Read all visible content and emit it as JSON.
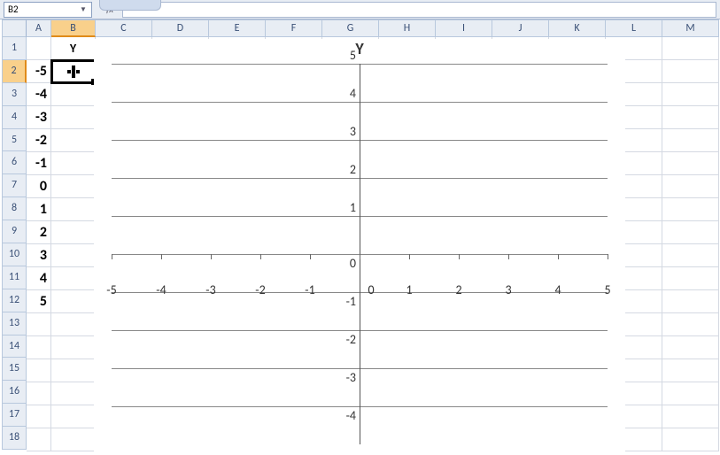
{
  "name_box": "B2",
  "formula_bar": "",
  "columns": [
    {
      "label": "A",
      "width": 28
    },
    {
      "label": "B",
      "width": 50
    },
    {
      "label": "C",
      "width": 64
    },
    {
      "label": "D",
      "width": 64
    },
    {
      "label": "E",
      "width": 64
    },
    {
      "label": "F",
      "width": 64
    },
    {
      "label": "G",
      "width": 64
    },
    {
      "label": "H",
      "width": 64
    },
    {
      "label": "I",
      "width": 64
    },
    {
      "label": "J",
      "width": 64
    },
    {
      "label": "K",
      "width": 64
    },
    {
      "label": "L",
      "width": 64
    },
    {
      "label": "M",
      "width": 64
    }
  ],
  "rows": [
    {
      "num": 1,
      "cells": [
        "",
        "Y",
        "",
        "",
        "",
        "",
        "",
        "",
        "",
        "",
        "",
        "",
        ""
      ]
    },
    {
      "num": 2,
      "cells": [
        "-5",
        "",
        "",
        "",
        "",
        "",
        "",
        "",
        "",
        "",
        "",
        "",
        ""
      ]
    },
    {
      "num": 3,
      "cells": [
        "-4",
        "",
        "",
        "",
        "",
        "",
        "",
        "",
        "",
        "",
        "",
        "",
        ""
      ]
    },
    {
      "num": 4,
      "cells": [
        "-3",
        "",
        "",
        "",
        "",
        "",
        "",
        "",
        "",
        "",
        "",
        "",
        ""
      ]
    },
    {
      "num": 5,
      "cells": [
        "-2",
        "",
        "",
        "",
        "",
        "",
        "",
        "",
        "",
        "",
        "",
        "",
        ""
      ]
    },
    {
      "num": 6,
      "cells": [
        "-1",
        "",
        "",
        "",
        "",
        "",
        "",
        "",
        "",
        "",
        "",
        "",
        ""
      ]
    },
    {
      "num": 7,
      "cells": [
        "0",
        "",
        "",
        "",
        "",
        "",
        "",
        "",
        "",
        "",
        "",
        "",
        ""
      ]
    },
    {
      "num": 8,
      "cells": [
        "1",
        "",
        "",
        "",
        "",
        "",
        "",
        "",
        "",
        "",
        "",
        "",
        ""
      ]
    },
    {
      "num": 9,
      "cells": [
        "2",
        "",
        "",
        "",
        "",
        "",
        "",
        "",
        "",
        "",
        "",
        "",
        ""
      ]
    },
    {
      "num": 10,
      "cells": [
        "3",
        "",
        "",
        "",
        "",
        "",
        "",
        "",
        "",
        "",
        "",
        "",
        ""
      ]
    },
    {
      "num": 11,
      "cells": [
        "4",
        "",
        "",
        "",
        "",
        "",
        "",
        "",
        "",
        "",
        "",
        "",
        ""
      ]
    },
    {
      "num": 12,
      "cells": [
        "5",
        "",
        "",
        "",
        "",
        "",
        "",
        "",
        "",
        "",
        "",
        "",
        ""
      ]
    },
    {
      "num": 13,
      "cells": [
        "",
        "",
        "",
        "",
        "",
        "",
        "",
        "",
        "",
        "",
        "",
        "",
        ""
      ]
    },
    {
      "num": 14,
      "cells": [
        "",
        "",
        "",
        "",
        "",
        "",
        "",
        "",
        "",
        "",
        "",
        "",
        ""
      ]
    },
    {
      "num": 15,
      "cells": [
        "",
        "",
        "",
        "",
        "",
        "",
        "",
        "",
        "",
        "",
        "",
        "",
        ""
      ]
    },
    {
      "num": 16,
      "cells": [
        "",
        "",
        "",
        "",
        "",
        "",
        "",
        "",
        "",
        "",
        "",
        "",
        ""
      ]
    },
    {
      "num": 17,
      "cells": [
        "",
        "",
        "",
        "",
        "",
        "",
        "",
        "",
        "",
        "",
        "",
        "",
        ""
      ]
    },
    {
      "num": 18,
      "cells": [
        "",
        "",
        "",
        "",
        "",
        "",
        "",
        "",
        "",
        "",
        "",
        "",
        ""
      ]
    }
  ],
  "selected_cell": {
    "row": 2,
    "col": 1
  },
  "selected_col": 1,
  "chart_data": {
    "type": "scatter",
    "title": "Y",
    "x_ticks": [
      -5,
      -4,
      -3,
      -2,
      -1,
      0,
      1,
      2,
      3,
      4,
      5
    ],
    "y_ticks": [
      5,
      4,
      3,
      2,
      1,
      0,
      -1,
      -2,
      -3,
      -4
    ],
    "xlim": [
      -5,
      5
    ],
    "ylim": [
      -5,
      5
    ],
    "y_axis_at_x": 0,
    "x_axis_at_y": 0,
    "series": [
      {
        "name": "Y",
        "x": [],
        "y": []
      }
    ]
  }
}
